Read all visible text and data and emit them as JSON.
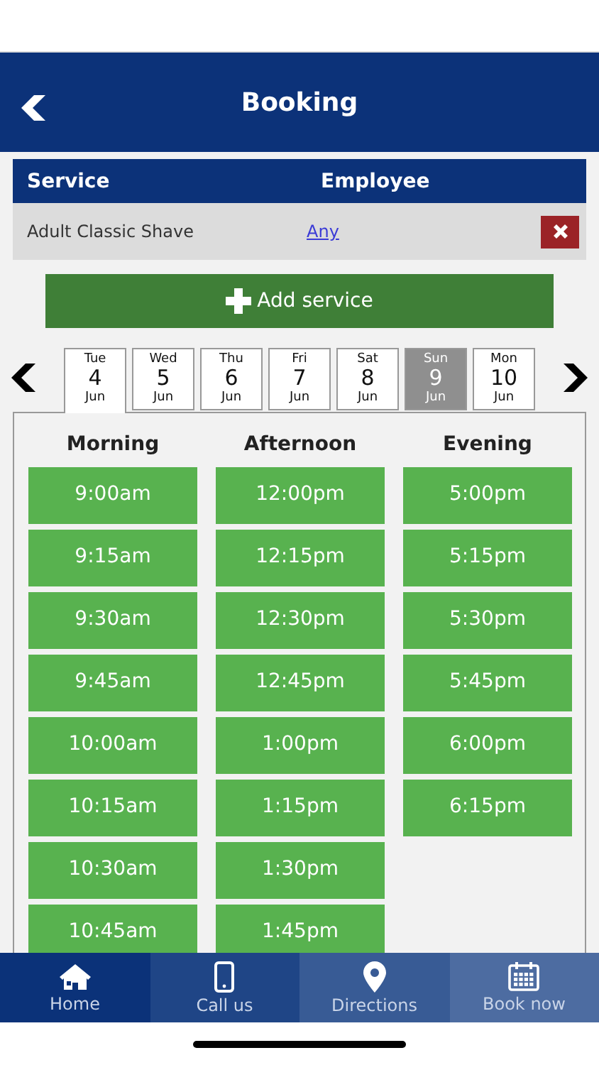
{
  "header": {
    "title": "Booking"
  },
  "services_table": {
    "columns": [
      "Service",
      "Employee"
    ],
    "rows": [
      {
        "service": "Adult Classic Shave",
        "employee": "Any"
      }
    ]
  },
  "add_service": {
    "label": "Add service"
  },
  "days": [
    {
      "weekday": "Tue",
      "day": "4",
      "month": "Jun",
      "selected": true,
      "disabled": false
    },
    {
      "weekday": "Wed",
      "day": "5",
      "month": "Jun",
      "selected": false,
      "disabled": false
    },
    {
      "weekday": "Thu",
      "day": "6",
      "month": "Jun",
      "selected": false,
      "disabled": false
    },
    {
      "weekday": "Fri",
      "day": "7",
      "month": "Jun",
      "selected": false,
      "disabled": false
    },
    {
      "weekday": "Sat",
      "day": "8",
      "month": "Jun",
      "selected": false,
      "disabled": false
    },
    {
      "weekday": "Sun",
      "day": "9",
      "month": "Jun",
      "selected": false,
      "disabled": true
    },
    {
      "weekday": "Mon",
      "day": "10",
      "month": "Jun",
      "selected": false,
      "disabled": false
    }
  ],
  "periods": [
    {
      "title": "Morning",
      "slots": [
        "9:00am",
        "9:15am",
        "9:30am",
        "9:45am",
        "10:00am",
        "10:15am",
        "10:30am",
        "10:45am"
      ]
    },
    {
      "title": "Afternoon",
      "slots": [
        "12:00pm",
        "12:15pm",
        "12:30pm",
        "12:45pm",
        "1:00pm",
        "1:15pm",
        "1:30pm",
        "1:45pm"
      ]
    },
    {
      "title": "Evening",
      "slots": [
        "5:00pm",
        "5:15pm",
        "5:30pm",
        "5:45pm",
        "6:00pm",
        "6:15pm"
      ]
    }
  ],
  "bottom_nav": [
    {
      "kind": "home",
      "label": "Home",
      "color": "#0b3279"
    },
    {
      "kind": "phone",
      "label": "Call us",
      "color": "#1f4586"
    },
    {
      "kind": "pin",
      "label": "Directions",
      "color": "#385b95"
    },
    {
      "kind": "calendar",
      "label": "Book now",
      "color": "#4d6ca1"
    }
  ]
}
